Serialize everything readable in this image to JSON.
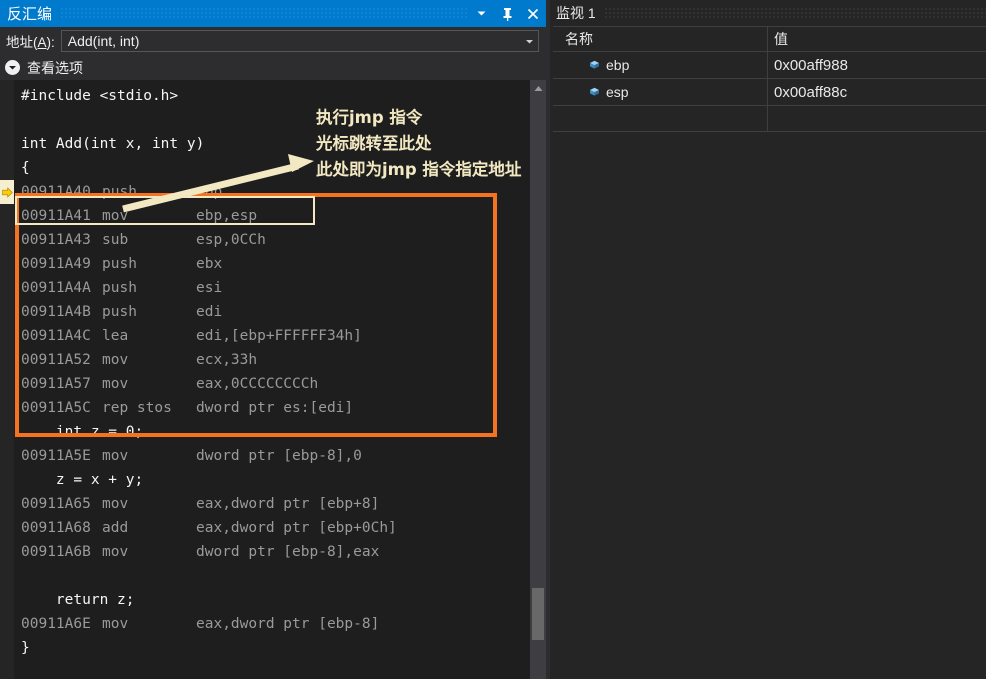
{
  "disassembly_panel": {
    "title": "反汇编",
    "titlebar_buttons": [
      {
        "name": "window-menu-dropdown",
        "icon": "chevron-down-icon"
      },
      {
        "name": "pin-window",
        "icon": "pin-icon"
      },
      {
        "name": "close-window",
        "icon": "close-icon"
      }
    ],
    "address_bar": {
      "label_prefix": "地址(",
      "label_accesskey": "A",
      "label_suffix": "):",
      "value": "Add(int, int)",
      "placeholder": "Add(int, int)"
    },
    "view_options_label": "查看选项",
    "code_lines": [
      {
        "kind": "src",
        "text": "#include <stdio.h>"
      },
      {
        "kind": "blank",
        "text": ""
      },
      {
        "kind": "src",
        "text": "int Add(int x, int y)"
      },
      {
        "kind": "src",
        "text": "{"
      },
      {
        "kind": "asm",
        "current": true,
        "address": "00911A40",
        "mnemonic": "push",
        "operands": "ebp"
      },
      {
        "kind": "asm",
        "current": false,
        "address": "00911A41",
        "mnemonic": "mov",
        "operands": "ebp,esp"
      },
      {
        "kind": "asm",
        "current": false,
        "address": "00911A43",
        "mnemonic": "sub",
        "operands": "esp,0CCh"
      },
      {
        "kind": "asm",
        "current": false,
        "address": "00911A49",
        "mnemonic": "push",
        "operands": "ebx"
      },
      {
        "kind": "asm",
        "current": false,
        "address": "00911A4A",
        "mnemonic": "push",
        "operands": "esi"
      },
      {
        "kind": "asm",
        "current": false,
        "address": "00911A4B",
        "mnemonic": "push",
        "operands": "edi"
      },
      {
        "kind": "asm",
        "current": false,
        "address": "00911A4C",
        "mnemonic": "lea",
        "operands": "edi,[ebp+FFFFFF34h]"
      },
      {
        "kind": "asm",
        "current": false,
        "address": "00911A52",
        "mnemonic": "mov",
        "operands": "ecx,33h"
      },
      {
        "kind": "asm",
        "current": false,
        "address": "00911A57",
        "mnemonic": "mov",
        "operands": "eax,0CCCCCCCCh"
      },
      {
        "kind": "asm",
        "current": false,
        "address": "00911A5C",
        "mnemonic": "rep stos",
        "operands": "dword ptr es:[edi]"
      },
      {
        "kind": "src",
        "text": "    int z = 0;"
      },
      {
        "kind": "asm",
        "current": false,
        "address": "00911A5E",
        "mnemonic": "mov",
        "operands": "dword ptr [ebp-8],0"
      },
      {
        "kind": "src",
        "text": "    z = x + y;"
      },
      {
        "kind": "asm",
        "current": false,
        "address": "00911A65",
        "mnemonic": "mov",
        "operands": "eax,dword ptr [ebp+8]"
      },
      {
        "kind": "asm",
        "current": false,
        "address": "00911A68",
        "mnemonic": "add",
        "operands": "eax,dword ptr [ebp+0Ch]"
      },
      {
        "kind": "asm",
        "current": false,
        "address": "00911A6B",
        "mnemonic": "mov",
        "operands": "dword ptr [ebp-8],eax"
      },
      {
        "kind": "blank",
        "text": ""
      },
      {
        "kind": "src",
        "text": "    return z;"
      },
      {
        "kind": "asm",
        "current": false,
        "address": "00911A6E",
        "mnemonic": "mov",
        "operands": "eax,dword ptr [ebp-8]"
      },
      {
        "kind": "src",
        "text": "}"
      }
    ]
  },
  "watch_panel": {
    "title": "监视 1",
    "columns": [
      "名称",
      "值"
    ],
    "rows": [
      {
        "icon": "variable-cube-icon",
        "name": "ebp",
        "value": "0x00aff988"
      },
      {
        "icon": "variable-cube-icon",
        "name": "esp",
        "value": "0x00aff88c"
      }
    ],
    "empty_row": {
      "name": "",
      "value": ""
    }
  },
  "annotation": {
    "lines": [
      "执行jmp 指令",
      "光标跳转至此处",
      "此处即为jmp 指令指定地址"
    ],
    "arrow": "arrow-pointing-up-right",
    "highlight_box_color": "#f47321",
    "callout_box_color": "#f2e8c2",
    "text_color": "#f2e8c2"
  },
  "colors": {
    "accent_blue": "#007acc",
    "editor_bg": "#1e1e1e",
    "chrome_bg": "#2d2d30",
    "panel_bg": "#252526",
    "source_text": "#f5f5f5",
    "asm_text": "#9a9a9a",
    "marker_yellow": "#ffcc00"
  }
}
